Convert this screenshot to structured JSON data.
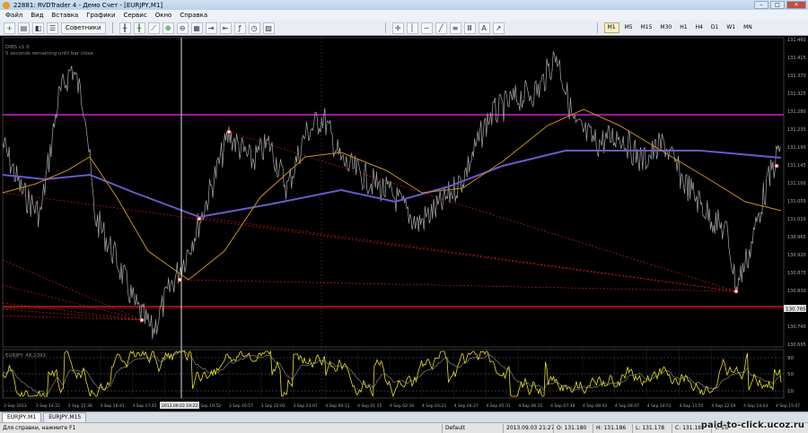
{
  "window": {
    "title": "22881: RVDTrader 4 - Демо Счет - [EURJPY,M1]",
    "buttons": [
      "–",
      "□",
      "✕"
    ]
  },
  "menu": [
    "Файл",
    "Вид",
    "Вставка",
    "Графики",
    "Сервис",
    "Окно",
    "Справка"
  ],
  "toolbar": {
    "advisors_label": "Советники",
    "timeframes": [
      "M1",
      "M5",
      "M15",
      "M30",
      "H1",
      "H4",
      "D1",
      "W1",
      "MN"
    ],
    "active_timeframe": "M1"
  },
  "chart": {
    "indicator_info_1": "DIBS v1.0",
    "indicator_info_2": "5 seconds remaining until bar close",
    "price_labels": [
      "131.460",
      "131.415",
      "131.370",
      "131.325",
      "131.280",
      "131.235",
      "131.190",
      "131.145",
      "131.100",
      "131.055",
      "131.010",
      "130.965",
      "130.920",
      "130.875",
      "130.830",
      "130.785",
      "130.740",
      "130.695"
    ],
    "current_price": "130.785",
    "time_labels": [
      "3 Sep 2013",
      "3 Sep 14:22",
      "3 Sep 15:36",
      "3 Sep 16:41",
      "3 Sep 17:45",
      "2013.09.03 19:22",
      "3 Sep 19:52",
      "3 Sep 20:57",
      "3 Sep 22:01",
      "3 Sep 23:07",
      "4 Sep 00:11",
      "4 Sep 01:15",
      "4 Sep 02:19",
      "4 Sep 03:23",
      "4 Sep 04:27",
      "4 Sep 05:31",
      "4 Sep 06:35",
      "4 Sep 07:39",
      "4 Sep 08:43",
      "4 Sep 09:47",
      "4 Sep 10:51",
      "4 Sep 11:55",
      "4 Sep 12:59",
      "4 Sep 14:03",
      "4 Sep 15:07"
    ],
    "oscillator_label": "EURJPY: 48.2391",
    "oscillator_levels": [
      "90",
      "50",
      "10"
    ],
    "colors": {
      "price": "#a8a8a8",
      "ma_slow": "#6a5acd",
      "ma_fast": "#c8901e",
      "resistance": "#d020d0",
      "support": "#e02020",
      "oscillator_main": "#e8e020",
      "oscillator_signal": "#808080"
    }
  },
  "tabs": [
    "EURJPY,M1",
    "EURJPY,M15"
  ],
  "status": {
    "help": "Для справки, нажмите F1",
    "profile": "Default",
    "datetime": "2013.09.03 21:27",
    "open": "O: 131.180",
    "high": "H: 131.186",
    "low": "L: 131.178",
    "close": "C: 131.184",
    "volume": "V: 26"
  },
  "watermark": "paid-to-click.ucoz.ru"
}
